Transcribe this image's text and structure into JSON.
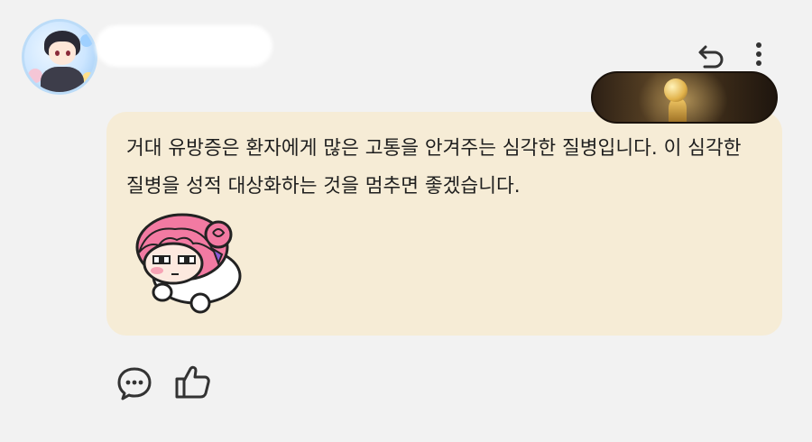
{
  "comment": {
    "text": "거대 유방증은 환자에게 많은 고통을 안겨주는 심각한 질병입니다. 이 심각한 질병을 성적 대상화하는 것을 멈추면 좋겠습니다."
  },
  "header": {
    "avatar_icon": "user-avatar-anime",
    "username_redacted": true,
    "reply_icon": "reply-arrow-icon",
    "more_icon": "more-vertical-icon"
  },
  "badge": {
    "icon": "golden-trophy-badge"
  },
  "sticker": {
    "icon": "pink-hair-chibi-sticker"
  },
  "actions": {
    "comment_icon": "speech-bubble-icon",
    "like_icon": "thumbs-up-icon"
  },
  "colors": {
    "background": "#f2f2f2",
    "bubble": "#f6ecd6",
    "text": "#1e1e1e",
    "icon": "#333333"
  }
}
